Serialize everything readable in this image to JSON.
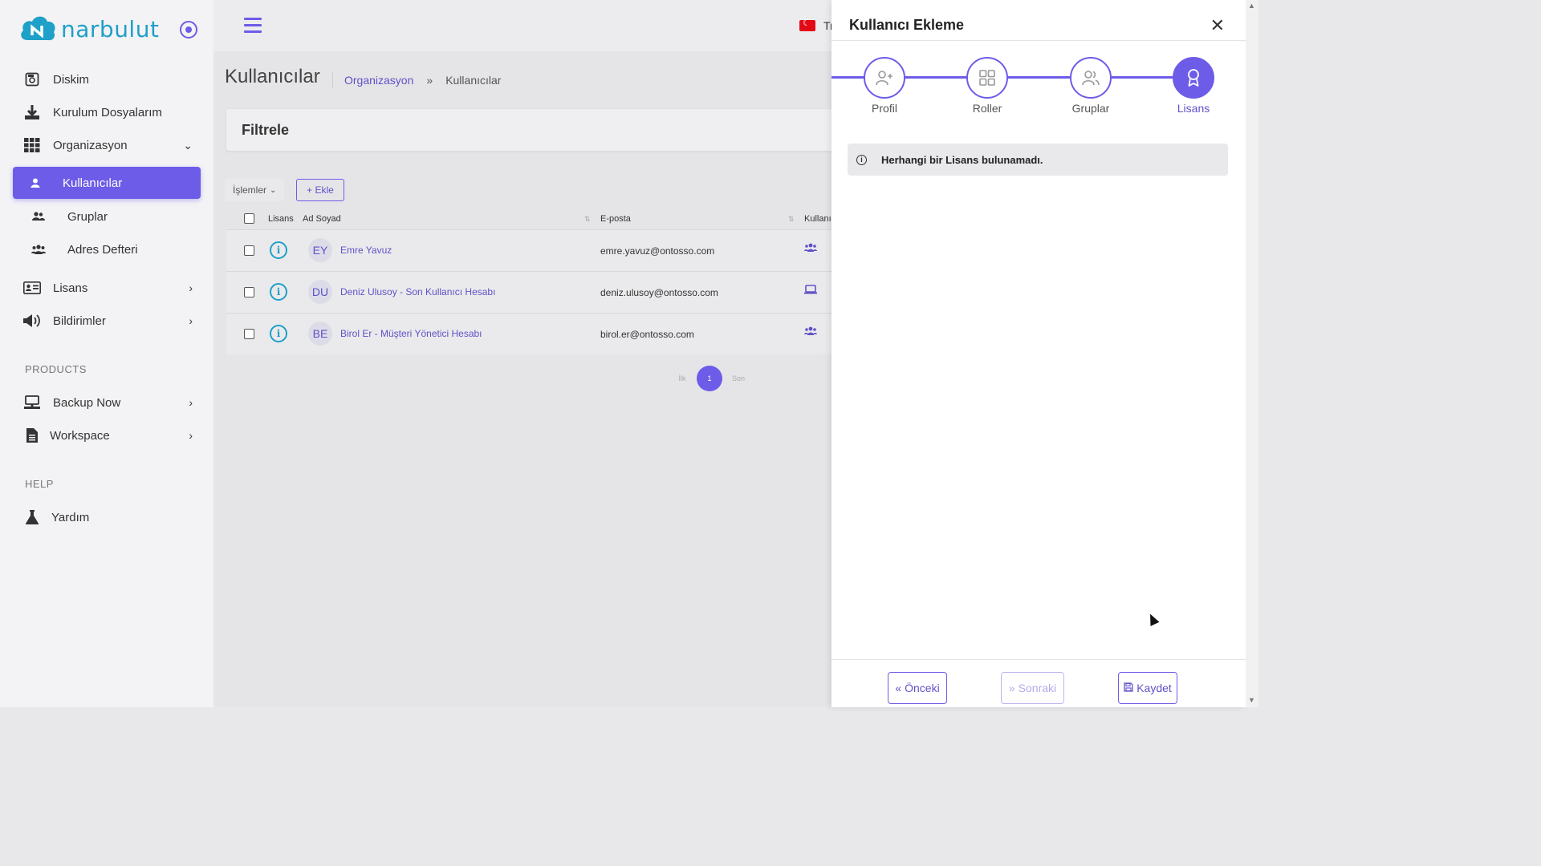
{
  "brand": {
    "name": "narbulut",
    "color": "#1ea0c8",
    "accent": "#6d5ce8"
  },
  "sidebar": {
    "items": [
      {
        "label": "Diskim",
        "icon": "disk-icon"
      },
      {
        "label": "Kurulum Dosyalarım",
        "icon": "download-icon"
      },
      {
        "label": "Organizasyon",
        "icon": "grid-icon"
      },
      {
        "label": "Kullanıcılar",
        "icon": "user-icon"
      },
      {
        "label": "Gruplar",
        "icon": "users-icon"
      },
      {
        "label": "Adres Defteri",
        "icon": "address-book-icon"
      },
      {
        "label": "Lisans",
        "icon": "license-icon"
      },
      {
        "label": "Bildirimler",
        "icon": "megaphone-icon"
      },
      {
        "label": "Backup Now",
        "icon": "computer-icon"
      },
      {
        "label": "Workspace",
        "icon": "document-icon"
      },
      {
        "label": "Yardım",
        "icon": "flask-icon"
      }
    ],
    "sections": {
      "products": "PRODUCTS",
      "help": "HELP"
    }
  },
  "topbar": {
    "language": "Tr"
  },
  "page": {
    "title": "Kullanıcılar",
    "breadcrumb": {
      "parent": "Organizasyon",
      "separator": "»",
      "current": "Kullanıcılar"
    },
    "filter_title": "Filtrele",
    "actions_label": "İşlemler",
    "add_label": "+ Ekle"
  },
  "table": {
    "headers": {
      "license": "Lisans",
      "name": "Ad Soyad",
      "email": "E-posta",
      "user": "Kullanı"
    },
    "rows": [
      {
        "initials": "EY",
        "name": "Emre Yavuz",
        "email": "emre.yavuz@ontosso.com",
        "type_icon": "users-icon"
      },
      {
        "initials": "DU",
        "name": "Deniz Ulusoy - Son Kullanıcı Hesabı",
        "email": "deniz.ulusoy@ontosso.com",
        "type_icon": "laptop-icon"
      },
      {
        "initials": "BE",
        "name": "Birol Er - Müşteri Yönetici Hesabı",
        "email": "birol.er@ontosso.com",
        "type_icon": "users-icon"
      }
    ]
  },
  "pagination": {
    "first": "İlk",
    "current": "1",
    "last": "Son"
  },
  "panel": {
    "title": "Kullanıcı Ekleme",
    "steps": [
      {
        "label": "Profil",
        "icon": "user-plus-icon"
      },
      {
        "label": "Roller",
        "icon": "grid-icon"
      },
      {
        "label": "Gruplar",
        "icon": "users-icon"
      },
      {
        "label": "Lisans",
        "icon": "award-icon"
      }
    ],
    "active_step": 3,
    "alert": "Herhangi bir Lisans bulunamadı.",
    "buttons": {
      "prev": "Önceki",
      "next": "Sonraki",
      "save": "Kaydet"
    }
  }
}
